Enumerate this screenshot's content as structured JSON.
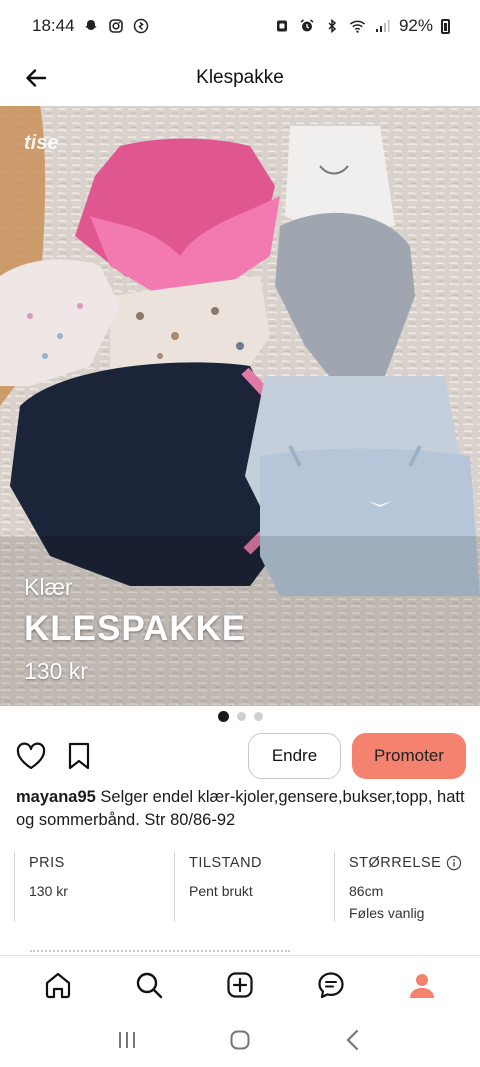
{
  "status_bar": {
    "time": "18:44",
    "battery": "92%",
    "left_icons": [
      "snapchat-icon",
      "instagram-icon",
      "activity-icon"
    ],
    "right_icons": [
      "alarm-icon",
      "alarm-clock-icon",
      "bluetooth-icon",
      "wifi-icon",
      "signal-icon",
      "battery-icon"
    ]
  },
  "header": {
    "title": "Klespakke",
    "back_icon": "arrow-left-icon"
  },
  "hero": {
    "brand": "tise",
    "category": "Klær",
    "name": "KLESPAKKE",
    "price": "130 kr"
  },
  "pager": {
    "count": 3,
    "active_index": 0
  },
  "actions": {
    "like_icon": "heart-icon",
    "save_icon": "bookmark-icon",
    "edit_label": "Endre",
    "promote_label": "Promoter",
    "colors": {
      "promote_bg": "#f4826e"
    }
  },
  "description": {
    "username": "mayana95",
    "text": "Selger endel klær-kjoler,gensere,bukser,topp, hatt og sommerbånd. Str 80/86-92"
  },
  "details": {
    "price": {
      "label": "PRIS",
      "value": "130 kr"
    },
    "condition": {
      "label": "TILSTAND",
      "value": "Pent brukt"
    },
    "size": {
      "label": "STØRRELSE",
      "value": "86cm",
      "fit": "Føles vanlig",
      "info_icon": "info-icon"
    }
  },
  "bottom_nav": {
    "items": [
      "home-icon",
      "search-icon",
      "add-icon",
      "chat-icon",
      "profile-icon"
    ],
    "active": "profile-icon",
    "colors": {
      "active": "#f4826e"
    }
  },
  "system_nav": [
    "recents-icon",
    "home-circle-icon",
    "back-chevron-icon"
  ]
}
